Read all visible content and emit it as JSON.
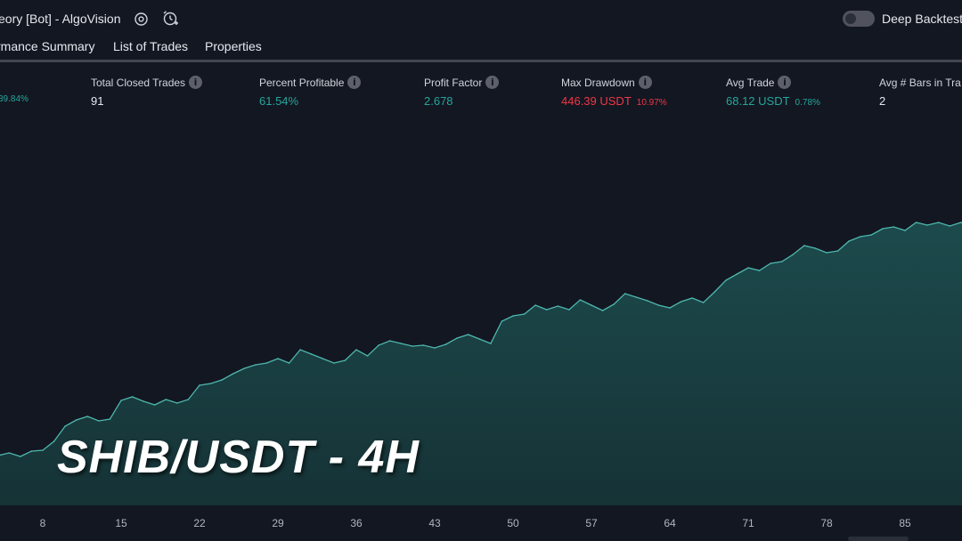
{
  "window": {
    "title": "eory [Bot] - AlgoVision",
    "toggle_label": "Deep Backtesti"
  },
  "tabs": [
    {
      "label": "rmance Summary"
    },
    {
      "label": "List of Trades"
    },
    {
      "label": "Properties"
    }
  ],
  "stats": {
    "partial_value": "39.84%",
    "total_closed_trades": {
      "label": "Total Closed Trades",
      "value": "91"
    },
    "percent_profitable": {
      "label": "Percent Profitable",
      "value": "61.54%"
    },
    "profit_factor": {
      "label": "Profit Factor",
      "value": "2.678"
    },
    "max_drawdown": {
      "label": "Max Drawdown",
      "value": "446.39 USDT",
      "sub": "10.97%"
    },
    "avg_trade": {
      "label": "Avg Trade",
      "value": "68.12 USDT",
      "sub": "0.78%"
    },
    "avg_bars": {
      "label": "Avg # Bars in Tra",
      "value": "2"
    }
  },
  "overlay": {
    "text": "SHIB/USDT - 4H"
  },
  "colors": {
    "positive": "#26a69a",
    "negative": "#f23645",
    "equity_line": "#4db6ac"
  },
  "chart_data": {
    "type": "area",
    "title": "",
    "xlabel": "",
    "ylabel": "",
    "x_ticks": [
      "8",
      "15",
      "22",
      "29",
      "36",
      "43",
      "50",
      "57",
      "64",
      "71",
      "78",
      "85"
    ],
    "x": [
      4,
      5,
      6,
      7,
      8,
      9,
      10,
      11,
      12,
      13,
      14,
      15,
      16,
      17,
      18,
      19,
      20,
      21,
      22,
      23,
      24,
      25,
      26,
      27,
      28,
      29,
      30,
      31,
      32,
      33,
      34,
      35,
      36,
      37,
      38,
      39,
      40,
      41,
      42,
      43,
      44,
      45,
      46,
      47,
      48,
      49,
      50,
      51,
      52,
      53,
      54,
      55,
      56,
      57,
      58,
      59,
      60,
      61,
      62,
      63,
      64,
      65,
      66,
      67,
      68,
      69,
      70,
      71,
      72,
      73,
      74,
      75,
      76,
      77,
      78,
      79,
      80,
      81,
      82,
      83,
      84,
      85,
      86,
      87,
      88,
      89,
      90,
      91
    ],
    "y": [
      8,
      11,
      7,
      13,
      14,
      24,
      41,
      48,
      52,
      47,
      49,
      70,
      74,
      69,
      65,
      71,
      67,
      71,
      87,
      89,
      93,
      100,
      106,
      110,
      112,
      117,
      112,
      127,
      122,
      117,
      112,
      115,
      127,
      120,
      132,
      137,
      134,
      131,
      132,
      129,
      133,
      140,
      144,
      139,
      134,
      159,
      165,
      167,
      177,
      172,
      176,
      172,
      183,
      177,
      171,
      178,
      190,
      186,
      182,
      177,
      174,
      181,
      185,
      180,
      192,
      205,
      212,
      219,
      216,
      224,
      226,
      234,
      244,
      241,
      236,
      238,
      249,
      254,
      256,
      263,
      265,
      261,
      270,
      267,
      270,
      266,
      270,
      265
    ]
  }
}
